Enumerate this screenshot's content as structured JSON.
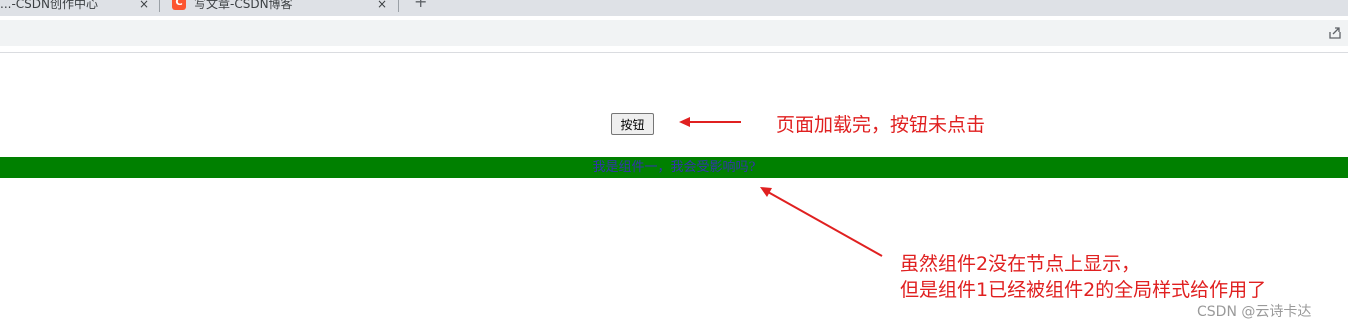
{
  "browser": {
    "tabs": [
      {
        "label": "...-CSDN创作中心",
        "close": "×"
      },
      {
        "label": "写文章-CSDN博客",
        "close": "×",
        "favicon": "C"
      }
    ],
    "new_tab": "+"
  },
  "page": {
    "button_label": "按钮",
    "component_text": "我是组件一，我会受影响吗?",
    "green_bar_color": "#008000"
  },
  "annotations": {
    "top": "页面加载完，按钮未点击",
    "bottom_line1": "虽然组件2没在节点上显示，",
    "bottom_line2": "但是组件1已经被组件2的全局样式给作用了",
    "color": "#e02020"
  },
  "watermark": "CSDN @云诗卡达"
}
